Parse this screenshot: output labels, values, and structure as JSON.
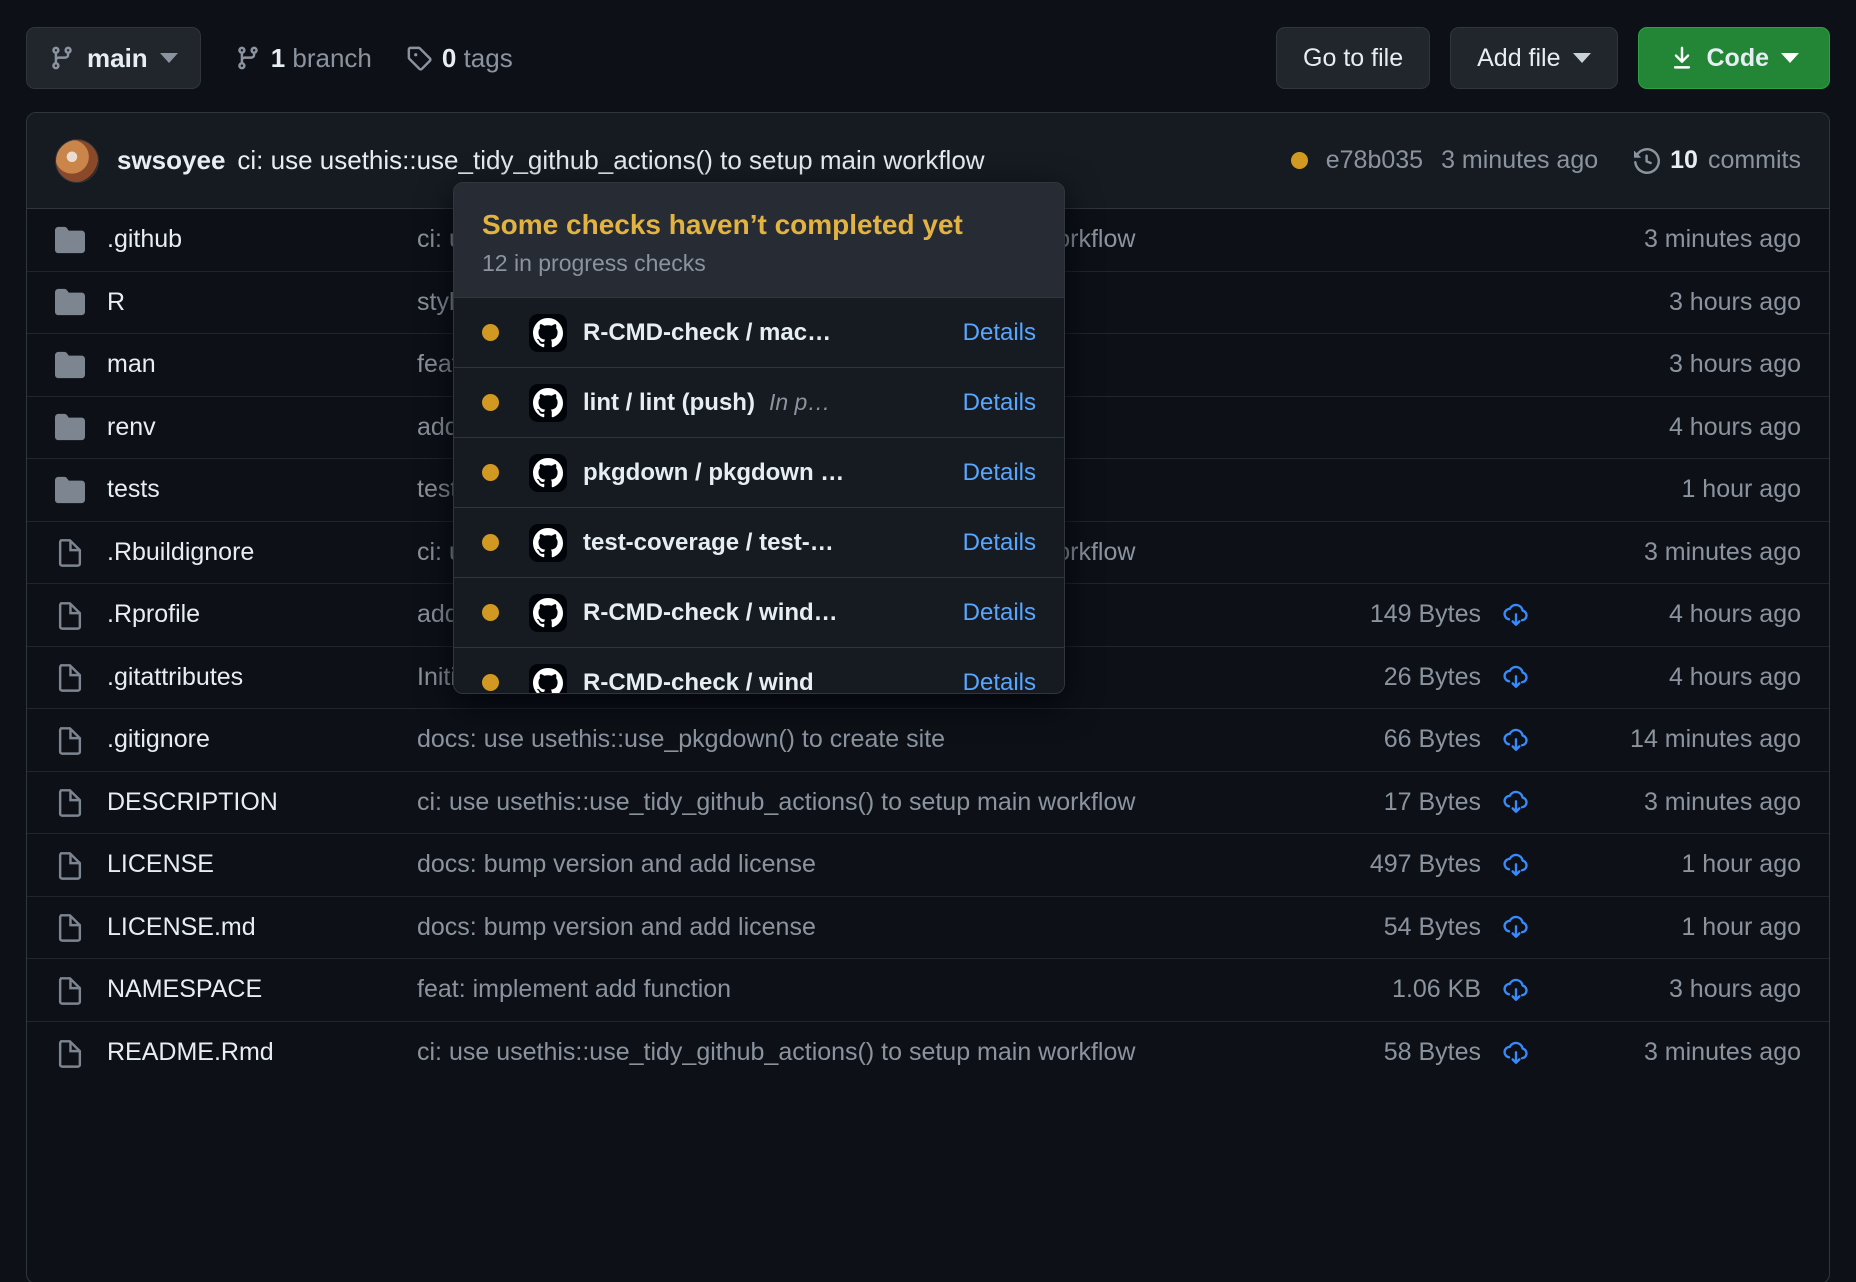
{
  "toolbar": {
    "branch_name": "main",
    "branch_icon": "git-branch-icon",
    "branch_caret_icon": "chevron-down-icon",
    "branch_count_num": "1",
    "branch_count_label": " branch",
    "tag_count_num": "0",
    "tag_count_label": " tags",
    "tag_icon": "tag-icon",
    "go_to_file_label": "Go to file",
    "add_file_label": "Add file",
    "code_label": "Code",
    "code_icon": "download-icon",
    "code_color": "#238636"
  },
  "commit_header": {
    "author": "swsoyee",
    "message": "ci: use usethis::use_tidy_github_actions() to setup main workflow",
    "status_color": "#d29922",
    "sha": "e78b035",
    "time": "3 minutes ago",
    "commits_count_num": "10",
    "commits_count_label": " commits",
    "history_icon": "history-icon"
  },
  "files": [
    {
      "icon": "folder-icon",
      "name": ".github",
      "message": "ci: use usethis::use_tidy_github_actions() to setup main workflow",
      "size": "",
      "lfs": false,
      "time": "3 minutes ago"
    },
    {
      "icon": "folder-icon",
      "name": "R",
      "message": "style: tidy up code style",
      "size": "",
      "lfs": false,
      "time": "3 hours ago"
    },
    {
      "icon": "folder-icon",
      "name": "man",
      "message": "feat: implement add function",
      "size": "",
      "lfs": false,
      "time": "3 hours ago"
    },
    {
      "icon": "folder-icon",
      "name": "renv",
      "message": "add: use renv to manage dependencies",
      "size": "",
      "lfs": false,
      "time": "4 hours ago"
    },
    {
      "icon": "folder-icon",
      "name": "tests",
      "message": "test: unit test for add()",
      "size": "",
      "lfs": false,
      "time": "1 hour ago"
    },
    {
      "icon": "file-icon",
      "name": ".Rbuildignore",
      "message": "ci: use usethis::use_tidy_github_actions() to setup main workflow",
      "size": "",
      "lfs": false,
      "time": "3 minutes ago"
    },
    {
      "icon": "file-icon",
      "name": ".Rprofile",
      "message": "add: use renv to manage dependencies",
      "size": "149 Bytes",
      "lfs": true,
      "time": "4 hours ago"
    },
    {
      "icon": "file-icon",
      "name": ".gitattributes",
      "message": "Initial commit",
      "size": "26 Bytes",
      "lfs": true,
      "time": "4 hours ago"
    },
    {
      "icon": "file-icon",
      "name": ".gitignore",
      "message": "docs: use usethis::use_pkgdown() to create site",
      "size": "66 Bytes",
      "lfs": true,
      "time": "14 minutes ago"
    },
    {
      "icon": "file-icon",
      "name": "DESCRIPTION",
      "message": "ci: use usethis::use_tidy_github_actions() to setup main workflow",
      "size": "17 Bytes",
      "lfs": true,
      "time": "3 minutes ago"
    },
    {
      "icon": "file-icon",
      "name": "LICENSE",
      "message": "docs: bump version and add license",
      "size": "497 Bytes",
      "lfs": true,
      "time": "1 hour ago"
    },
    {
      "icon": "file-icon",
      "name": "LICENSE.md",
      "message": "docs: bump version and add license",
      "size": "54 Bytes",
      "lfs": true,
      "time": "1 hour ago"
    },
    {
      "icon": "file-icon",
      "name": "NAMESPACE",
      "message": "feat: implement add function",
      "size": "1.06 KB",
      "lfs": true,
      "time": "3 hours ago"
    },
    {
      "icon": "file-icon",
      "name": "README.Rmd",
      "message": "ci: use usethis::use_tidy_github_actions() to setup main workflow",
      "size": "58 Bytes",
      "lfs": true,
      "time": "3 minutes ago"
    }
  ],
  "checks_popup": {
    "title": "Some checks haven’t completed yet",
    "subtitle": "12 in progress checks",
    "title_color": "#e3b341",
    "details_label": "Details",
    "items": [
      {
        "name": "R-CMD-check / mac…",
        "status": "",
        "icon": "github-icon",
        "dot_color": "#d29922"
      },
      {
        "name": "lint / lint (push)",
        "status": "In p…",
        "icon": "github-icon",
        "dot_color": "#d29922"
      },
      {
        "name": "pkgdown / pkgdown …",
        "status": "",
        "icon": "github-icon",
        "dot_color": "#d29922"
      },
      {
        "name": "test-coverage / test-…",
        "status": "",
        "icon": "github-icon",
        "dot_color": "#d29922"
      },
      {
        "name": "R-CMD-check / wind…",
        "status": "",
        "icon": "github-icon",
        "dot_color": "#d29922"
      },
      {
        "name": "R-CMD-check / wind",
        "status": "",
        "icon": "github-icon",
        "dot_color": "#d29922"
      }
    ]
  }
}
